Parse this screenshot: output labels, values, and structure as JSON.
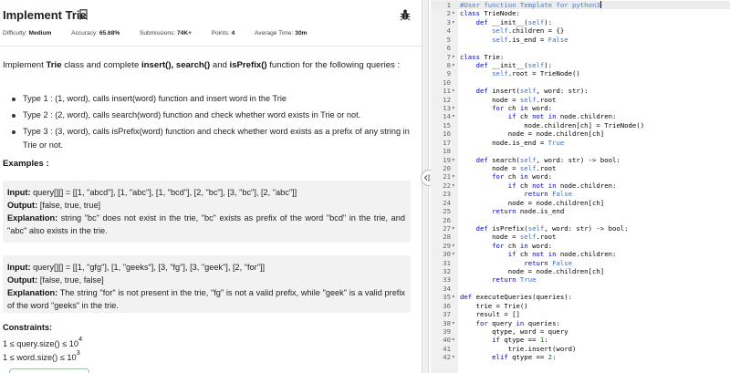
{
  "problem": {
    "title": "Implement Trie",
    "meta": {
      "difficulty_label": "Difficulty:",
      "difficulty_value": "Medium",
      "accuracy_label": "Accuracy:",
      "accuracy_value": "65.68%",
      "submissions_label": "Submissions:",
      "submissions_value": "74K+",
      "points_label": "Points:",
      "points_value": "4",
      "avg_time_label": "Average Time:",
      "avg_time_value": "30m"
    },
    "description": {
      "p1": "Implement ",
      "b1": "Trie",
      "p2": " class and complete ",
      "b2": "insert(), search()",
      "p3": " and ",
      "b3": "isPrefix()",
      "p4": " function for the following queries :"
    },
    "types": [
      "Type 1 : (1, word), calls insert(word) function and insert word in the Trie",
      "Type 2 : (2, word), calls search(word) function and check whether word exists in Trie or not.",
      "Type 3 : (3, word), calls isPrefix(word) function and check whether word exists as a prefix of any string in Trie or not."
    ],
    "examples_heading": "Examples :",
    "example1": {
      "input_label": "Input:",
      "input_value": " query[][] = [[1, \"abcd\"], [1, \"abc\"], [1, \"bcd\"], [2, \"bc\"], [3, \"bc\"], [2, \"abc\"]]",
      "output_label": "Output:",
      "output_value": " [false, true, true]",
      "explanation_label": "Explanation:",
      "explanation_value": " string \"bc\" does not exist in the trie, \"bc\" exists as prefix of the word \"bcd\" in the trie, and \"abc\" also exists in the trie."
    },
    "example2": {
      "input_label": "Input:",
      "input_value": " query[][] = [[1, \"gfg\"], [1, \"geeks\"], [3, \"fg\"], [3, \"geek\"], [2, \"for\"]]",
      "output_label": "Output:",
      "output_value": " [false, true, false]",
      "explanation_label": "Explanation:",
      "explanation_value": " The string \"for\" is not present in the trie, \"fg\" is not a valid prefix, while \"geek\" is a valid prefix of the word \"geeks\" in the trie."
    },
    "constraints_heading": "Constraints:",
    "constraint1_base": "1 ≤ query.size() ≤ 10",
    "constraint1_exp": "4",
    "constraint2_base": "1 ≤ word.size() ≤ 10",
    "constraint2_exp": "3"
  },
  "editor": {
    "lines": [
      {
        "n": "1",
        "fold": "",
        "text": "#User function Template for python3"
      },
      {
        "n": "2",
        "fold": "▾",
        "text": "class TrieNode:"
      },
      {
        "n": "3",
        "fold": "▾",
        "text": "    def __init__(self):"
      },
      {
        "n": "4",
        "fold": "",
        "text": "        self.children = {}"
      },
      {
        "n": "5",
        "fold": "",
        "text": "        self.is_end = False"
      },
      {
        "n": "6",
        "fold": "",
        "text": ""
      },
      {
        "n": "7",
        "fold": "▾",
        "text": "class Trie:"
      },
      {
        "n": "8",
        "fold": "▾",
        "text": "    def __init__(self):"
      },
      {
        "n": "9",
        "fold": "",
        "text": "        self.root = TrieNode()"
      },
      {
        "n": "10",
        "fold": "",
        "text": ""
      },
      {
        "n": "11",
        "fold": "▾",
        "text": "    def insert(self, word: str):"
      },
      {
        "n": "12",
        "fold": "",
        "text": "        node = self.root"
      },
      {
        "n": "13",
        "fold": "▾",
        "text": "        for ch in word:"
      },
      {
        "n": "14",
        "fold": "▾",
        "text": "            if ch not in node.children:"
      },
      {
        "n": "15",
        "fold": "",
        "text": "                node.children[ch] = TrieNode()"
      },
      {
        "n": "16",
        "fold": "",
        "text": "            node = node.children[ch]"
      },
      {
        "n": "17",
        "fold": "",
        "text": "        node.is_end = True"
      },
      {
        "n": "18",
        "fold": "",
        "text": ""
      },
      {
        "n": "19",
        "fold": "▾",
        "text": "    def search(self, word: str) -> bool:"
      },
      {
        "n": "20",
        "fold": "",
        "text": "        node = self.root"
      },
      {
        "n": "21",
        "fold": "▾",
        "text": "        for ch in word:"
      },
      {
        "n": "22",
        "fold": "▾",
        "text": "            if ch not in node.children:"
      },
      {
        "n": "23",
        "fold": "",
        "text": "                return False"
      },
      {
        "n": "24",
        "fold": "",
        "text": "            node = node.children[ch]"
      },
      {
        "n": "25",
        "fold": "",
        "text": "        return node.is_end"
      },
      {
        "n": "26",
        "fold": "",
        "text": ""
      },
      {
        "n": "27",
        "fold": "▾",
        "text": "    def isPrefix(self, word: str) -> bool:"
      },
      {
        "n": "28",
        "fold": "",
        "text": "        node = self.root"
      },
      {
        "n": "29",
        "fold": "▾",
        "text": "        for ch in word:"
      },
      {
        "n": "30",
        "fold": "▾",
        "text": "            if ch not in node.children:"
      },
      {
        "n": "31",
        "fold": "",
        "text": "                return False"
      },
      {
        "n": "32",
        "fold": "",
        "text": "            node = node.children[ch]"
      },
      {
        "n": "33",
        "fold": "",
        "text": "        return True"
      },
      {
        "n": "34",
        "fold": "",
        "text": ""
      },
      {
        "n": "35",
        "fold": "▾",
        "text": "def executeQueries(queries):"
      },
      {
        "n": "36",
        "fold": "",
        "text": "    trie = Trie()"
      },
      {
        "n": "37",
        "fold": "",
        "text": "    result = []"
      },
      {
        "n": "38",
        "fold": "▾",
        "text": "    for query in queries:"
      },
      {
        "n": "39",
        "fold": "",
        "text": "        qtype, word = query"
      },
      {
        "n": "40",
        "fold": "▾",
        "text": "        if qtype == 1:"
      },
      {
        "n": "41",
        "fold": "",
        "text": "            trie.insert(word)"
      },
      {
        "n": "42",
        "fold": "▾",
        "text": "        elif qtype == 2:"
      }
    ]
  },
  "colors": {
    "accent_green": "#2f8d46",
    "editor_gutter": "#f0f0f0",
    "keyword_blue": "#0000cc"
  }
}
